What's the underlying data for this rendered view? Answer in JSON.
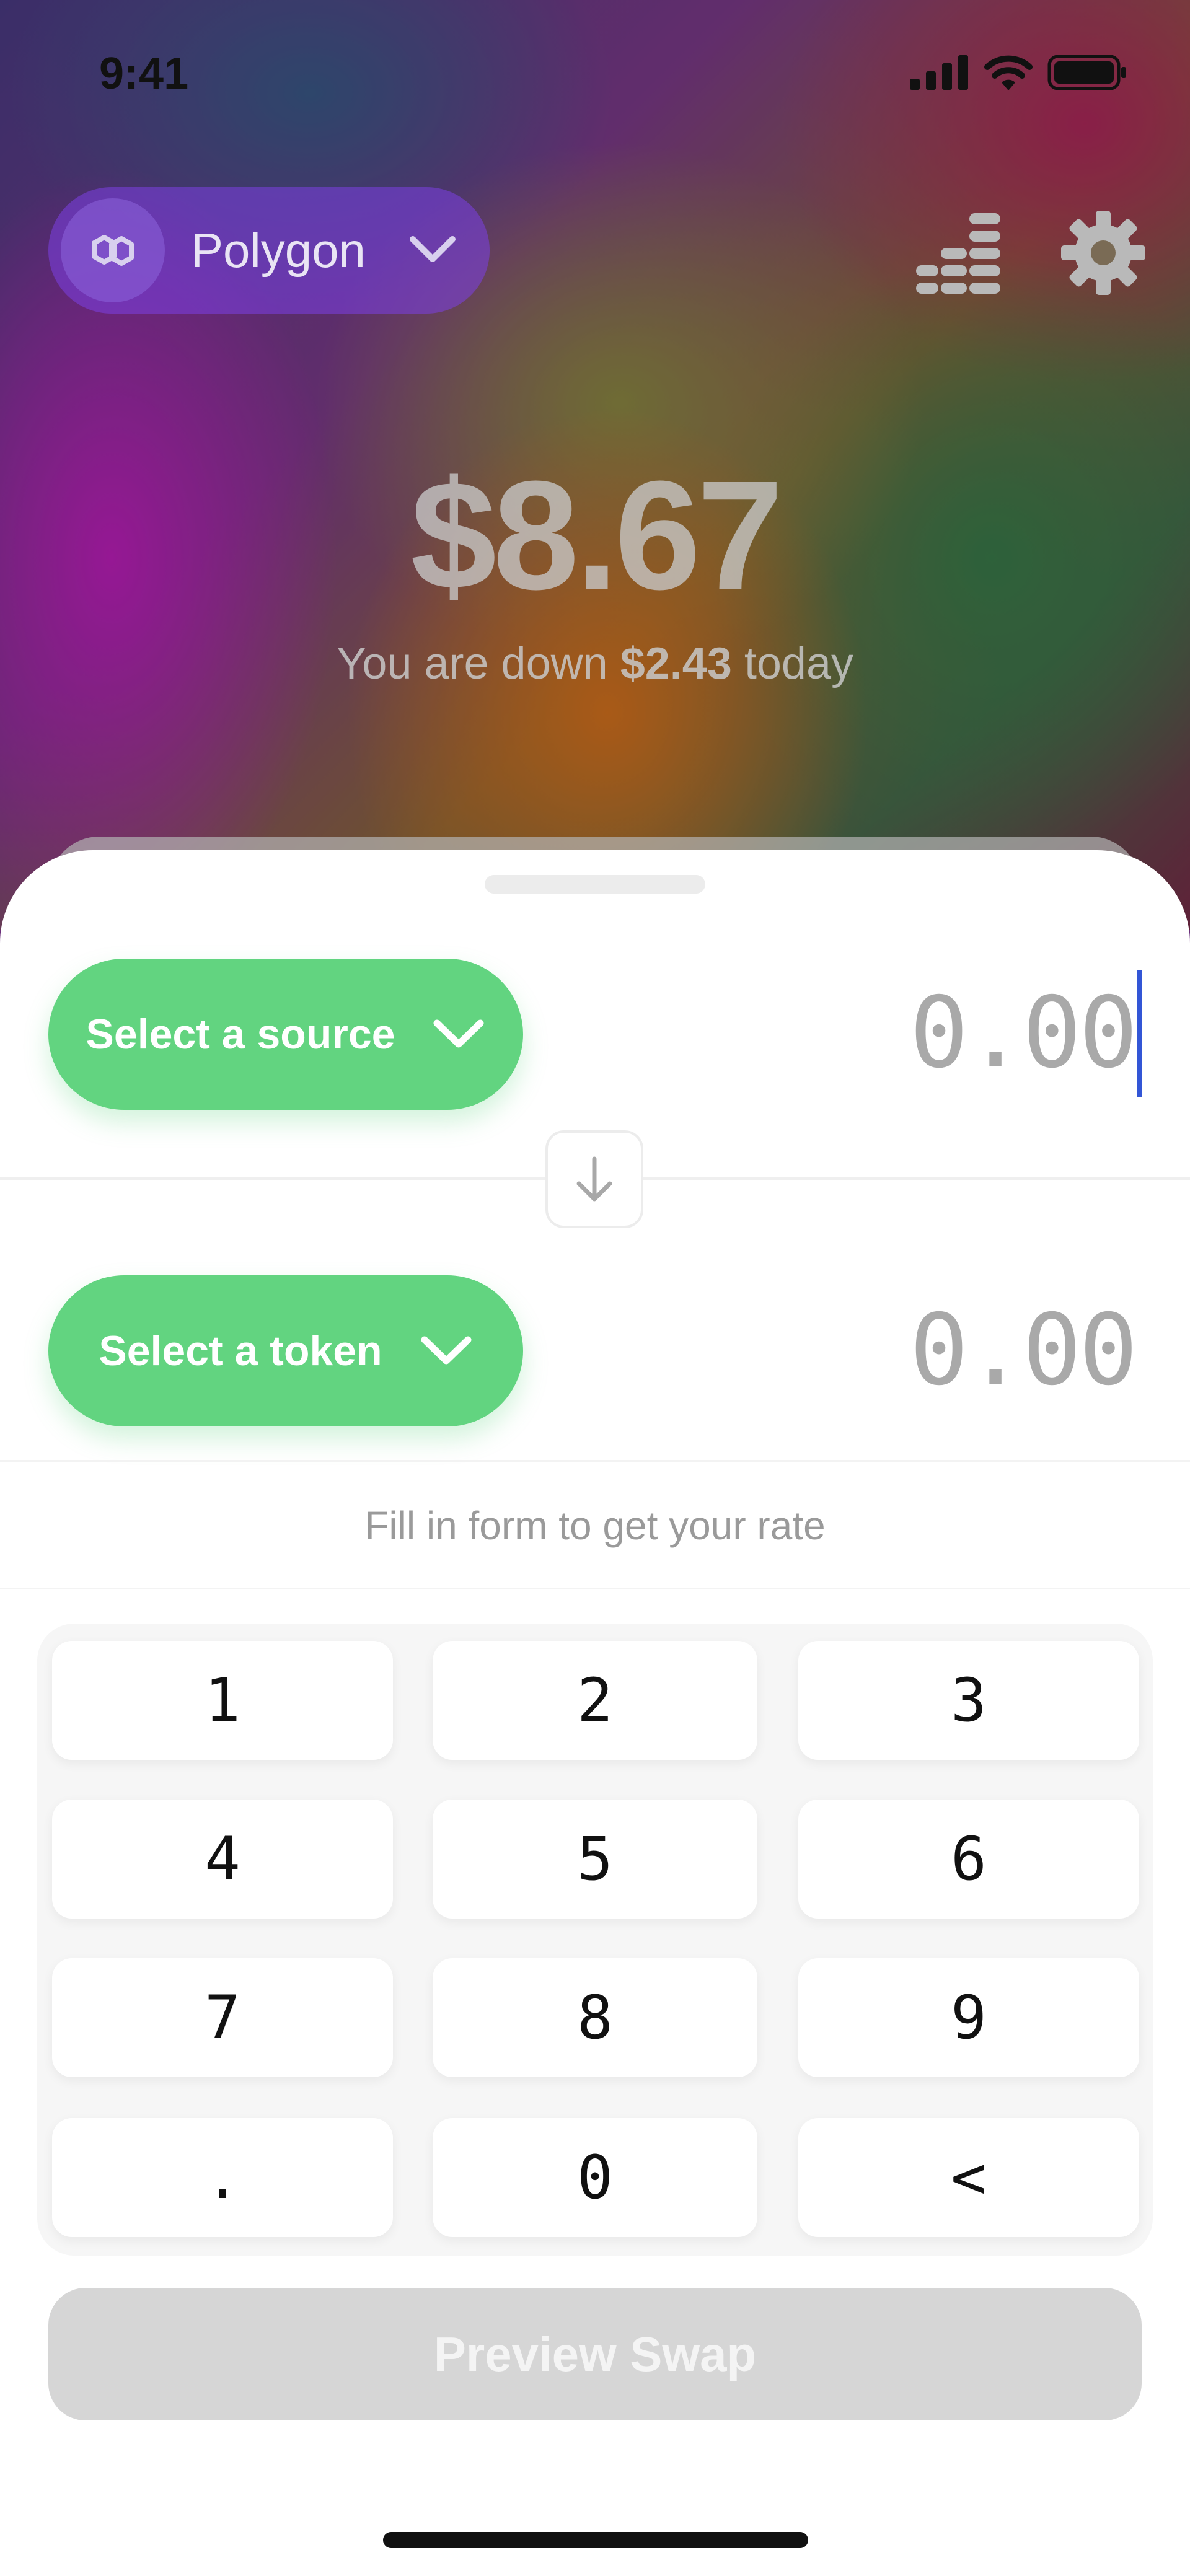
{
  "status_bar": {
    "time": "9:41"
  },
  "header": {
    "network_name": "Polygon",
    "network_icon": "polygon-logo-icon",
    "chart_icon": "bar-stack-icon",
    "settings_icon": "gear-icon"
  },
  "portfolio": {
    "balance": "$8.67",
    "change_prefix": "You are down ",
    "change_amount": "$2.43",
    "change_suffix": " today"
  },
  "swap": {
    "source_button": "Select a source",
    "source_amount": "0.00",
    "token_button": "Select a token",
    "token_amount": "0.00",
    "rate_hint": "Fill in form to get your rate"
  },
  "keypad": {
    "k1": "1",
    "k2": "2",
    "k3": "3",
    "k4": "4",
    "k5": "5",
    "k6": "6",
    "k7": "7",
    "k8": "8",
    "k9": "9",
    "kdot": ".",
    "k0": "0",
    "kback": "<"
  },
  "preview_button": "Preview Swap",
  "colors": {
    "accent_green": "#62d480",
    "caret_blue": "#3356d6",
    "disabled_gray": "#d6d6d6"
  }
}
